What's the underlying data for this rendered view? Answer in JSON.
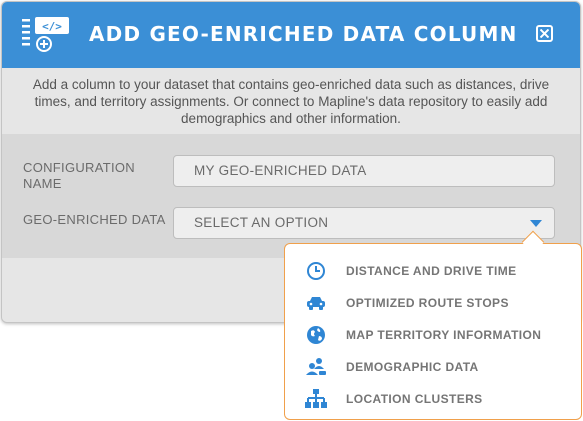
{
  "dialog": {
    "title": "ADD GEO-ENRICHED DATA COLUMN",
    "description": "Add a column to your dataset that contains geo-enriched data such as distances, drive times, and territory assignments. Or connect to Mapline's data repository to easily add demographics and other information."
  },
  "form": {
    "config_name_label": "CONFIGURATION NAME",
    "config_name_value": "MY GEO-ENRICHED DATA",
    "geo_label": "GEO-ENRICHED DATA",
    "geo_select_value": "SELECT AN OPTION"
  },
  "options": [
    {
      "label": "DISTANCE AND DRIVE TIME",
      "icon": "clock-icon"
    },
    {
      "label": "OPTIMIZED ROUTE STOPS",
      "icon": "car-icon"
    },
    {
      "label": "MAP TERRITORY INFORMATION",
      "icon": "globe-icon"
    },
    {
      "label": "DEMOGRAPHIC DATA",
      "icon": "people-icon"
    },
    {
      "label": "LOCATION CLUSTERS",
      "icon": "hierarchy-icon"
    }
  ],
  "colors": {
    "header": "#3b8fd6",
    "accent": "#2f86d4",
    "popup_border": "#f0a04b"
  }
}
